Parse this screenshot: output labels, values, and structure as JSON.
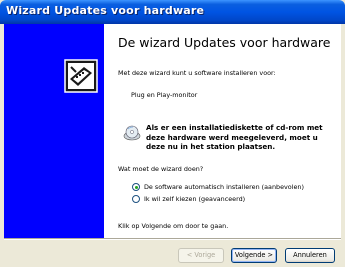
{
  "window": {
    "title": "Wizard Updates voor hardware"
  },
  "content": {
    "heading": "De wizard Updates voor hardware",
    "intro": "Met deze wizard kunt u software installeren voor:",
    "device": "Plug en Play-monitor",
    "cd_notice": [
      "Als er een installatiediskette of cd-rom met",
      "deze hardware werd meegeleverd, moet u",
      "deze nu in het station plaatsen."
    ],
    "question": "Wat moet de wizard doen?",
    "options": [
      {
        "label": "De software automatisch installeren (aanbevolen)",
        "selected": true
      },
      {
        "label": "Ik wil zelf kiezen (geavanceerd)",
        "selected": false
      }
    ],
    "footer": "Klik op Volgende om door te gaan."
  },
  "buttons": {
    "back": "< Vorige",
    "next": "Volgende >",
    "cancel": "Annuleren"
  },
  "colors": {
    "title_bar": "#0054e3",
    "left_panel": "#0000ff",
    "radio_selected": "#21a121"
  },
  "icons": {
    "wizard": "hardware-wizard-icon",
    "cd": "cd-rom-icon"
  }
}
